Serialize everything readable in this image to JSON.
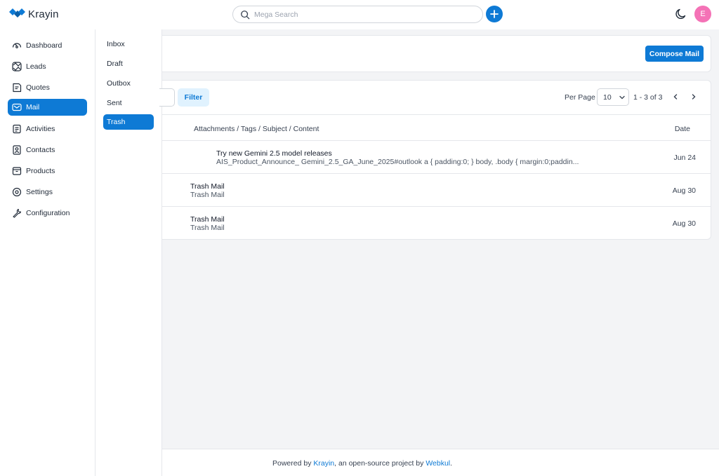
{
  "app": {
    "name": "Krayin"
  },
  "header": {
    "search_placeholder": "Mega Search",
    "avatar_initial": "E"
  },
  "sidebar": {
    "items": [
      {
        "label": "Dashboard",
        "icon": "dashboard-icon"
      },
      {
        "label": "Leads",
        "icon": "leads-icon"
      },
      {
        "label": "Quotes",
        "icon": "quotes-icon"
      },
      {
        "label": "Mail",
        "icon": "mail-icon",
        "active": true
      },
      {
        "label": "Activities",
        "icon": "activities-icon"
      },
      {
        "label": "Contacts",
        "icon": "contacts-icon"
      },
      {
        "label": "Products",
        "icon": "products-icon"
      },
      {
        "label": "Settings",
        "icon": "settings-icon"
      },
      {
        "label": "Configuration",
        "icon": "configuration-icon"
      }
    ]
  },
  "submenu": {
    "items": [
      {
        "label": "Inbox"
      },
      {
        "label": "Draft"
      },
      {
        "label": "Outbox"
      },
      {
        "label": "Sent"
      },
      {
        "label": "Trash",
        "active": true
      }
    ]
  },
  "toolbar": {
    "compose_label": "Compose Mail",
    "filter_label": "Filter",
    "per_page_label": "Per Page",
    "per_page_value": "10",
    "range_text": "1 - 3 of 3"
  },
  "table": {
    "columns": [
      "Attachments / Tags / Subject / Content",
      "Date"
    ],
    "rows": [
      {
        "subject": "Try new Gemini 2.5 model releases",
        "content": "AIS_Product_Announce_ Gemini_2.5_GA_June_2025#outlook a { padding:0; } body, .body { margin:0;paddin...",
        "date": "Jun 24"
      },
      {
        "subject": "Trash Mail",
        "content": "Trash Mail",
        "date": "Aug 30"
      },
      {
        "subject": "Trash Mail",
        "content": "Trash Mail",
        "date": "Aug 30"
      }
    ]
  },
  "footer": {
    "prefix": "Powered by ",
    "link1": "Krayin",
    "middle": ", an open-source project by ",
    "link2": "Webkul",
    "suffix": "."
  },
  "colors": {
    "primary": "#0e7ad5",
    "avatar": "#f472b6",
    "background": "#f3f4f6"
  }
}
